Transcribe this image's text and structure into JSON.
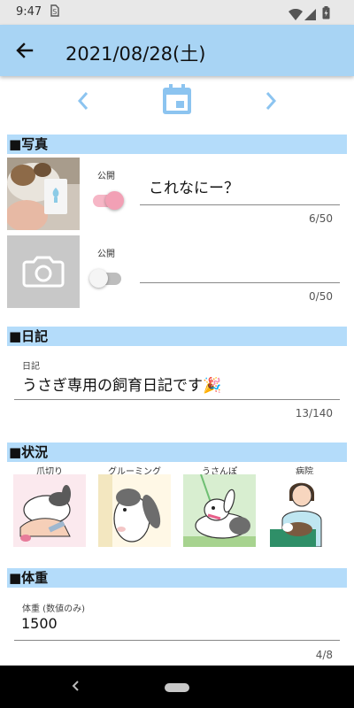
{
  "status_bar": {
    "time": "9:47",
    "sim_icon": "sim-card-icon"
  },
  "app_bar": {
    "title": "2021/08/28(土)",
    "back_icon": "arrow-left-icon"
  },
  "date_nav": {
    "prev_icon": "chevron-left-icon",
    "calendar_icon": "calendar-icon",
    "next_icon": "chevron-right-icon"
  },
  "colors": {
    "accent": "#a8d4f4",
    "section": "#b4dcfa",
    "icon_blue": "#8cc4f0",
    "toggle_on": "#f2a0b5"
  },
  "photo_section": {
    "header": "■写真",
    "items": [
      {
        "public_label": "公開",
        "public": true,
        "caption": "これなにー？",
        "counter": "6/50"
      },
      {
        "public_label": "公開",
        "public": false,
        "caption": "",
        "counter": "0/50",
        "placeholder_icon": "camera-icon"
      }
    ]
  },
  "diary_section": {
    "header": "■日記",
    "label": "日記",
    "value": "うさぎ専用の飼育日記です",
    "emoji": "🎉",
    "counter": "13/140"
  },
  "status_section": {
    "header": "■状況",
    "items": [
      {
        "label": "爪切り"
      },
      {
        "label": "グルーミング"
      },
      {
        "label": "うさんぽ"
      },
      {
        "label": "病院"
      }
    ]
  },
  "weight_section": {
    "header": "■体重",
    "label": "体重 (数値のみ)",
    "value": "1500",
    "counter": "4/8"
  }
}
